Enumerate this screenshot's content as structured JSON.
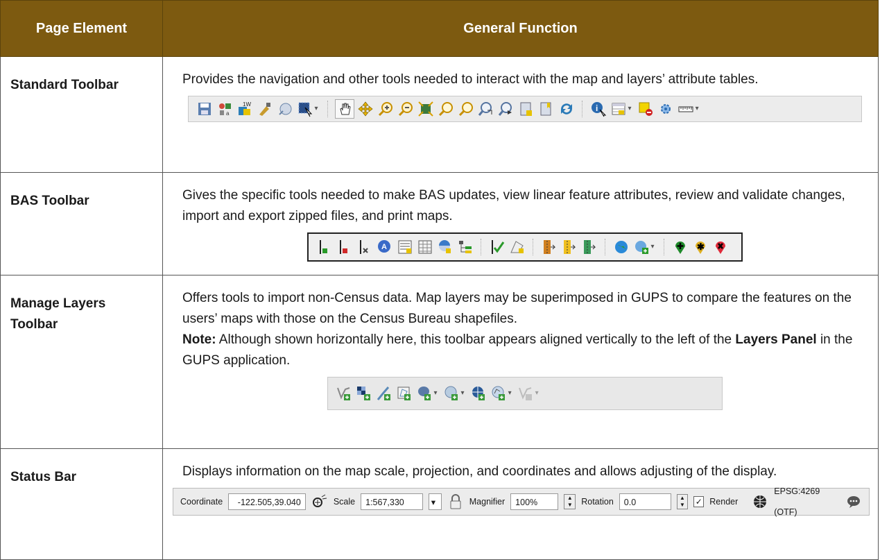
{
  "header": {
    "col1": "Page Element",
    "col2": "General Function"
  },
  "rows": [
    {
      "element": "Standard Toolbar",
      "desc": "Provides the navigation and other tools needed to interact with the map and layers’ attribute tables."
    },
    {
      "element": "BAS Toolbar",
      "desc": "Gives the specific tools needed to make BAS updates, view linear feature attributes, review and validate changes, import and export zipped files, and print maps."
    },
    {
      "element": "Manage Layers Toolbar",
      "desc": "Offers tools to import non-Census data. Map layers may be superimposed in GUPS to compare the features on the users’ maps with those on the Census Bureau shapefiles.",
      "note_label": "Note:",
      "note_a": "Although shown horizontally here, this toolbar appears aligned vertically to the left of the",
      "note_bold": "Layers Panel",
      "note_b": "in the GUPS application."
    },
    {
      "element": "Status Bar",
      "desc": "Displays information on the map scale, projection, and coordinates and allows adjusting of the display."
    }
  ],
  "statusbar": {
    "coord_label": "Coordinate",
    "coord_value": "-122.505,39.040",
    "scale_label": "Scale",
    "scale_value": "1:567,330",
    "magnifier_label": "Magnifier",
    "magnifier_value": "100%",
    "rotation_label": "Rotation",
    "rotation_value": "0.0",
    "render_label": "Render",
    "crs_label": "EPSG:4269 (OTF)"
  },
  "icons": {
    "standard": [
      "save-icon",
      "style-manager-icon",
      "new-layer-icon",
      "identify-brush-icon",
      "map-tips-icon",
      "select-icon",
      "pan-icon",
      "pan-to-selection-icon",
      "zoom-in-icon",
      "zoom-out-icon",
      "zoom-full-icon",
      "zoom-to-selection-icon",
      "zoom-to-layer-icon",
      "zoom-last-icon",
      "zoom-next-icon",
      "new-bookmark-icon",
      "show-bookmarks-icon",
      "refresh-icon",
      "identify-features-icon",
      "open-attribute-table-icon",
      "deselect-icon",
      "statistics-icon",
      "measure-icon"
    ],
    "bas": [
      "add-line-icon",
      "delete-line-icon",
      "split-line-icon",
      "attribute-lookup-icon",
      "attribute-table-icon",
      "spreadsheet-icon",
      "review-icon",
      "tree-icon",
      "validate-icon",
      "edit-polygon-icon",
      "import-zip-icon",
      "export-zip-icon",
      "export-zip-2-icon",
      "globe-icon",
      "globe-add-icon",
      "add-point-icon",
      "star-point-icon",
      "delete-point-icon"
    ],
    "manage": [
      "add-vector-layer-icon",
      "add-raster-layer-icon",
      "add-delimited-text-icon",
      "add-spatialite-icon",
      "add-postgis-icon",
      "add-wms-icon",
      "add-wcs-icon",
      "add-wfs-icon",
      "add-virtual-layer-icon"
    ]
  }
}
